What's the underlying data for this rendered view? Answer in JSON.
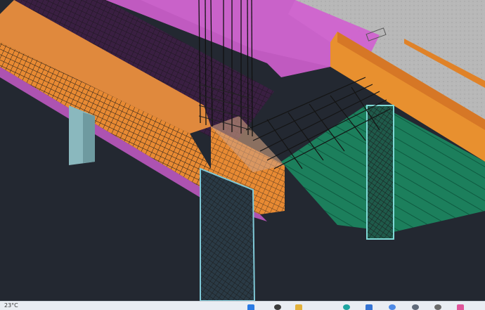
{
  "taskbar": {
    "weather": "23°C",
    "icons": [
      "windows-start-icon",
      "search-icon",
      "file-explorer-icon",
      "browser-icon",
      "store-icon",
      "chrome-icon",
      "app-icon",
      "settings-icon",
      "app-icon-2"
    ],
    "icon_colors": [
      "#2b7be4",
      "#3c3c3c",
      "#e3b23c",
      "#1ea5a1",
      "#3574d4",
      "#4e8ae6",
      "#5f6a7a",
      "#6b6b6b",
      "#e0569b"
    ]
  },
  "colors": {
    "background": "#232831",
    "concrete_slab": "#b9b9b9",
    "beam_concrete": "#e88a33",
    "formwork_magenta": "#d94fd0",
    "slab_green": "#1e8a63",
    "column_cyan": "#7fc8d6",
    "rebar": "#141414"
  }
}
